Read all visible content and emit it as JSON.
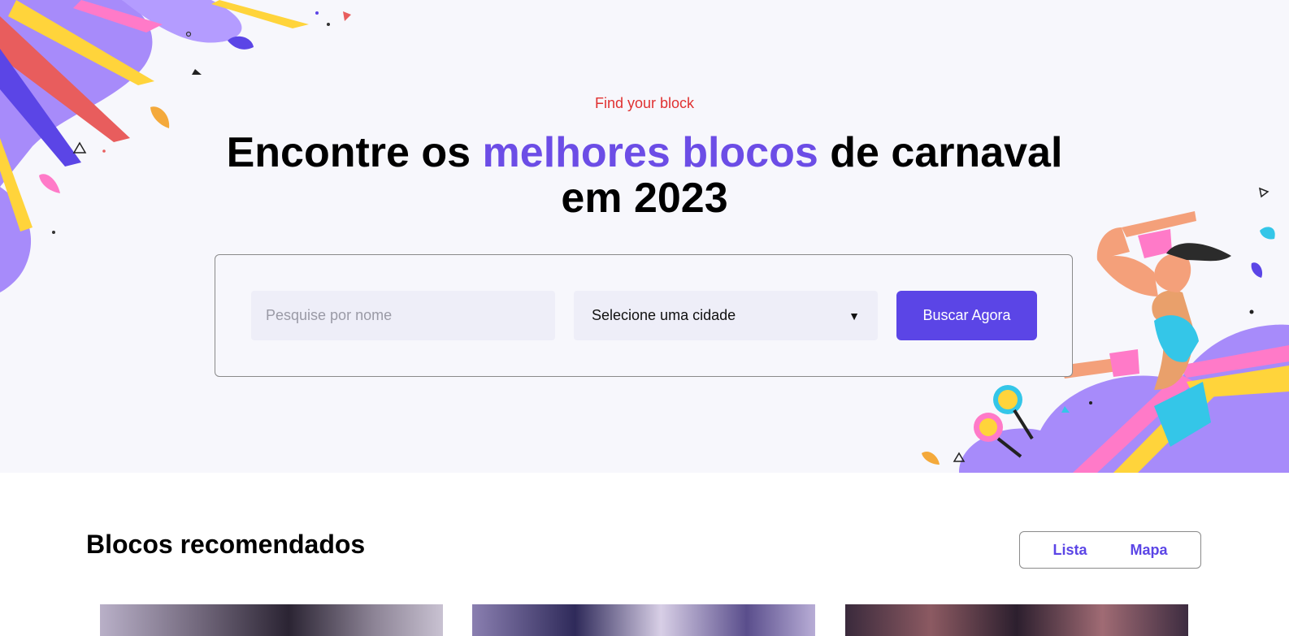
{
  "hero": {
    "eyebrow": "Find your block",
    "headline_pre": "Encontre os ",
    "headline_accent": "melhores blocos",
    "headline_post": " de carnaval em 2023"
  },
  "search": {
    "name_placeholder": "Pesquise por nome",
    "city_selected": "Selecione uma cidade",
    "button_label": "Buscar Agora"
  },
  "recommended": {
    "title": "Blocos recomendados",
    "view_list": "Lista",
    "view_map": "Mapa"
  },
  "colors": {
    "accent": "#5b45e6",
    "eyebrow": "#e03131",
    "hero_bg": "#f7f7fc"
  }
}
